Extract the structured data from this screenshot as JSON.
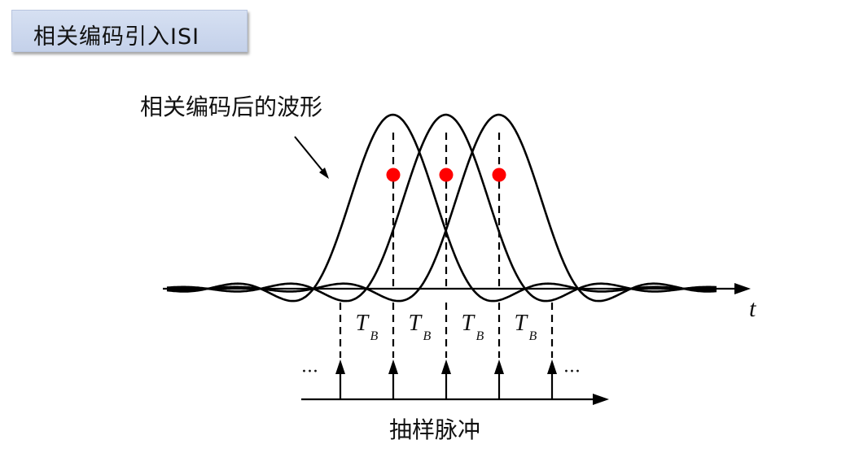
{
  "title": "相关编码引入ISI",
  "waveform_label": "相关编码后的波形",
  "time_axis_label": "t",
  "interval_symbol": "T",
  "interval_subscript": "B",
  "intervals": 4,
  "ellipsis": "···",
  "sampling_label": "抽样脉冲",
  "sample_points": 3,
  "colors": {
    "line": "#000000",
    "sample_point": "#ff0000",
    "title_bg": "#cdd8ee"
  }
}
